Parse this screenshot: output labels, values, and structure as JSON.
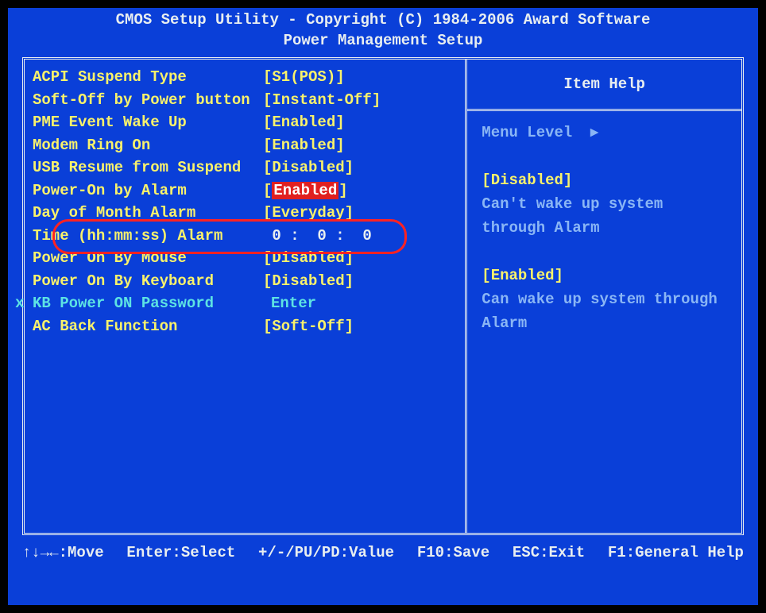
{
  "header": {
    "line1": "CMOS Setup Utility - Copyright (C) 1984-2006 Award Software",
    "line2": "Power Management Setup"
  },
  "settings": [
    {
      "label": "ACPI Suspend Type",
      "value": "[S1(POS)]",
      "highlight": false,
      "style": "yellow"
    },
    {
      "label": "Soft-Off by Power button",
      "value": "[Instant-Off]",
      "highlight": false,
      "style": "yellow"
    },
    {
      "label": "PME Event Wake Up",
      "value": "[Enabled]",
      "highlight": false,
      "style": "yellow"
    },
    {
      "label": "Modem Ring On",
      "value": "[Enabled]",
      "highlight": false,
      "style": "yellow"
    },
    {
      "label": "USB Resume from Suspend",
      "value": "[Disabled]",
      "highlight": false,
      "style": "yellow"
    },
    {
      "label": "Power-On by Alarm",
      "value": "Enabled",
      "highlight": true,
      "style": "yellow"
    },
    {
      "label": "Day of Month Alarm",
      "value": "[Everyday]",
      "highlight": false,
      "style": "yellow"
    },
    {
      "label": "Time (hh:mm:ss) Alarm",
      "value": " 0 :  0 :  0",
      "highlight": false,
      "style": "white"
    },
    {
      "label": "Power On By Mouse",
      "value": "[Disabled]",
      "highlight": false,
      "style": "yellow"
    },
    {
      "label": "Power On By Keyboard",
      "value": "[Disabled]",
      "highlight": false,
      "style": "yellow"
    },
    {
      "label": "KB Power ON Password",
      "value": "Enter",
      "highlight": false,
      "style": "cyan",
      "marker": "x"
    },
    {
      "label": "AC Back Function",
      "value": "[Soft-Off]",
      "highlight": false,
      "style": "yellow"
    }
  ],
  "help": {
    "title": "Item Help",
    "menu_level": "Menu Level",
    "arrow": "▸",
    "blocks": [
      {
        "title": "[Disabled]",
        "text": "Can't wake up system through Alarm"
      },
      {
        "title": "[Enabled]",
        "text": "Can wake up system through Alarm"
      }
    ]
  },
  "footer": {
    "move": "↑↓→←:Move",
    "select": "Enter:Select",
    "value": "+/-/PU/PD:Value",
    "save": "F10:Save",
    "exit": "ESC:Exit",
    "help": "F1:General Help"
  }
}
